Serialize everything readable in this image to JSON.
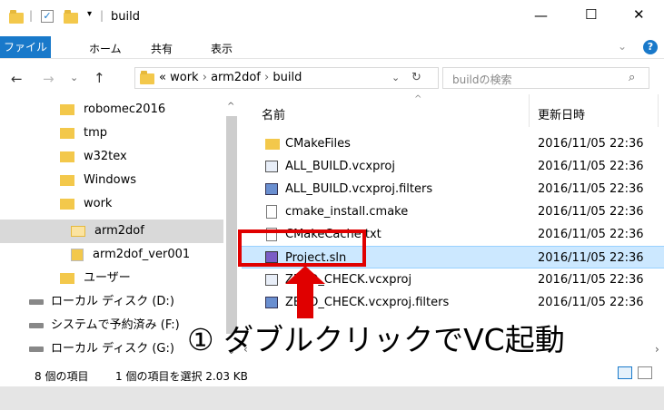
{
  "window": {
    "title": "build",
    "controls": {
      "minimize": "—",
      "maximize": "☐",
      "close": "✕"
    }
  },
  "ribbon": {
    "tabs": [
      "ファイル",
      "ホーム",
      "共有",
      "表示"
    ]
  },
  "address": {
    "prefix": "«",
    "crumbs": [
      "work",
      "arm2dof",
      "build"
    ],
    "search_placeholder": "buildの検索"
  },
  "nav": {
    "items": [
      {
        "label": "robomec2016"
      },
      {
        "label": "tmp"
      },
      {
        "label": "w32tex"
      },
      {
        "label": "Windows"
      },
      {
        "label": "work"
      },
      {
        "label": "arm2dof"
      },
      {
        "label": "arm2dof_ver001"
      },
      {
        "label": "ユーザー"
      },
      {
        "label": "ローカル ディスク (D:)"
      },
      {
        "label": "システムで予約済み (F:)"
      },
      {
        "label": "ローカル ディスク (G:)"
      }
    ]
  },
  "columns": {
    "name": "名前",
    "date": "更新日時"
  },
  "files": [
    {
      "name": "CMakeFiles",
      "date": "2016/11/05 22:36",
      "icon": "folder-icon"
    },
    {
      "name": "ALL_BUILD.vcxproj",
      "date": "2016/11/05 22:36",
      "icon": "vcxproj-icon"
    },
    {
      "name": "ALL_BUILD.vcxproj.filters",
      "date": "2016/11/05 22:36",
      "icon": "filters-icon"
    },
    {
      "name": "cmake_install.cmake",
      "date": "2016/11/05 22:36",
      "icon": "file-icon"
    },
    {
      "name": "CMakeCache.txt",
      "date": "2016/11/05 22:36",
      "icon": "text-file-icon"
    },
    {
      "name": "Project.sln",
      "date": "2016/11/05 22:36",
      "icon": "vs-solution-icon"
    },
    {
      "name": "ZERO_CHECK.vcxproj",
      "date": "2016/11/05 22:36",
      "icon": "vcxproj-icon"
    },
    {
      "name": "ZERO_CHECK.vcxproj.filters",
      "date": "2016/11/05 22:36",
      "icon": "filters-icon"
    }
  ],
  "status": {
    "count": "8 個の項目",
    "selected": "1 個の項目を選択 2.03 KB"
  },
  "annotation": {
    "text": "① ダブルクリックでVC起動"
  },
  "colors": {
    "selection": "#cce8ff",
    "accent": "#1979ca",
    "annotation_red": "#e00000"
  }
}
